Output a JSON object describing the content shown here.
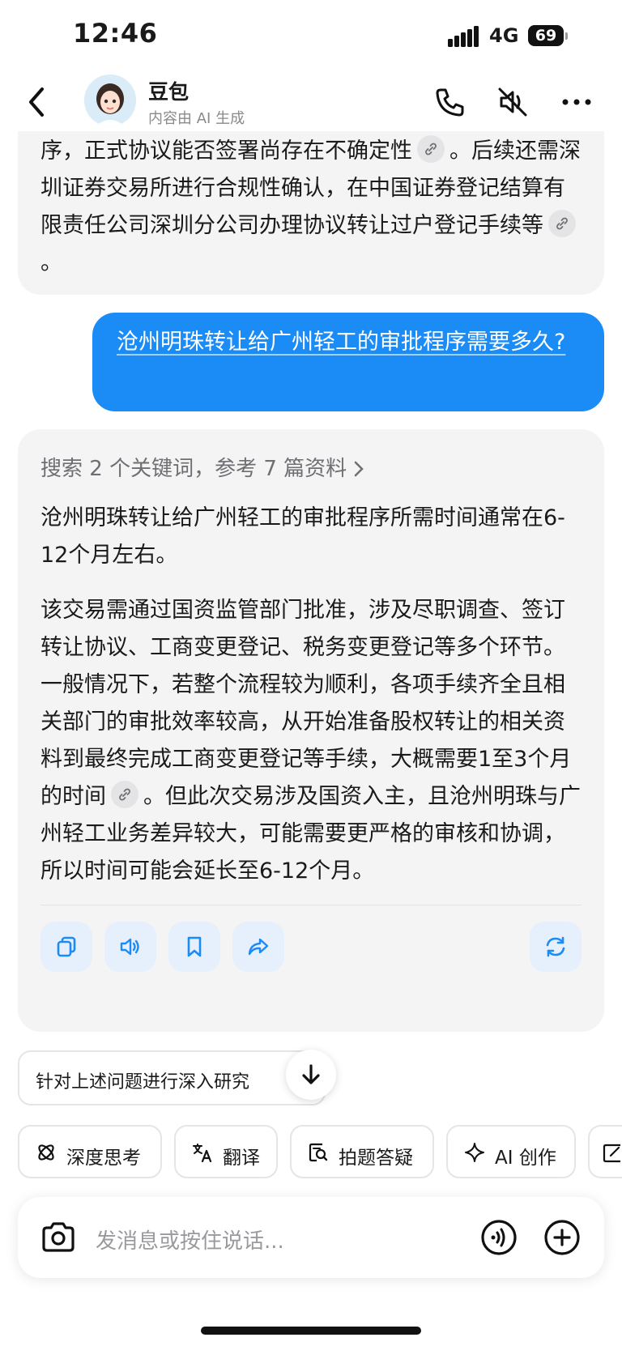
{
  "status": {
    "time": "12:46",
    "network": "4G",
    "battery": "69"
  },
  "header": {
    "title": "豆包",
    "subtitle": "内容由 AI 生成"
  },
  "prev_message": {
    "line1": "序，正式协议能否签署尚存在不确定性",
    "line1_tail": "。后续",
    "rest": "还需深圳证券交易所进行合规性确认，在中国证券登记结算有限责任公司深圳分公司办理协议转让过户登记手续等",
    "rest_tail": "。"
  },
  "user_message": {
    "text": "沧州明珠转让给广州轻工的审批程序需要多久?"
  },
  "ai_message": {
    "search_summary": "搜索 2 个关键词，参考 7 篇资料",
    "para1": "沧州明珠转让给广州轻工的审批程序所需时间通常在6-12个月左右。",
    "para2_a": "该交易需通过国资监管部门批准，涉及尽职调查、签订转让协议、工商变更登记、税务变更登记等多个环节。一般情况下，若整个流程较为顺利，各项手续齐全且相关部门的审批效率较高，从开始准备股权转让的相关资料到最终完成工商变更登记等手续，大概需要1至3个月的时间",
    "para2_b": "。但此次交易涉及国资入主，且沧州明珠与广州轻工业务差异较大，可能需要更严格的审核和协调，所以时间可能会延长至6-12个月。"
  },
  "suggestion": {
    "label": "针对上述问题进行深入研究"
  },
  "chips": [
    {
      "label": "深度思考",
      "icon": "atom-icon"
    },
    {
      "label": "翻译",
      "icon": "translate-icon"
    },
    {
      "label": "拍题答疑",
      "icon": "photo-question-icon"
    },
    {
      "label": "AI 创作",
      "icon": "sparkle-icon"
    }
  ],
  "input": {
    "placeholder": "发消息或按住说话..."
  },
  "colors": {
    "accent": "#1b8cf6",
    "bubble_ai": "#f4f4f5",
    "action_bg": "#e6f0fc"
  }
}
